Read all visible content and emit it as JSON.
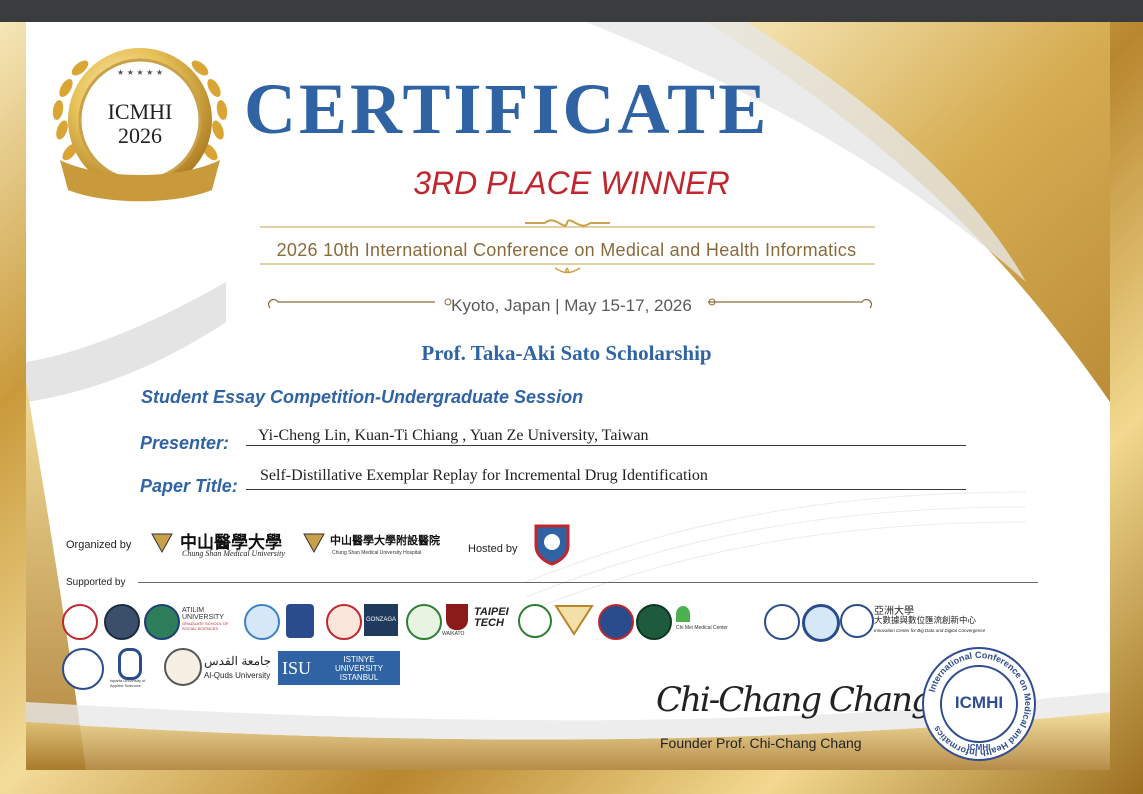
{
  "seal": {
    "line1": "ICMHI",
    "line2": "2026"
  },
  "certificate_title": "CERTIFICATE",
  "award": "3RD PLACE WINNER",
  "conference": "2026 10th International Conference on Medical and Health Informatics",
  "location_date": "Kyoto, Japan | May 15-17, 2026",
  "scholarship": "Prof. Taka-Aki Sato Scholarship",
  "session": "Student Essay Competition-Undergraduate Session",
  "presenter": {
    "label": "Presenter:",
    "value": "Yi-Cheng Lin, Kuan-Ti Chiang , Yuan Ze University, Taiwan"
  },
  "paper_title": {
    "label": "Paper Title:",
    "value": "Self-Distillative Exemplar Replay for Incremental Drug Identification"
  },
  "organized_by": {
    "label": "Organized by",
    "org1": {
      "name": "中山醫學大學",
      "sub": "Chung Shan Medical University"
    },
    "org2": {
      "name": "中山醫學大學附設醫院",
      "sub": "Chung Shan Medical University Hospital"
    }
  },
  "hosted_by": "Hosted by",
  "supported_by": "Supported by",
  "supporter_text": {
    "atilim": "ATILIM UNIVERSITY",
    "atilim_sub": "GRADUATE SCHOOL OF SOCIAL SCIENCES",
    "gonzaga": "GONZAGA",
    "waikato": "WAIKATO",
    "taipei_tech": "TAIPEI TECH",
    "chimei": "Chi Mei Medical Center",
    "asia_cn": "亞洲大學",
    "asia_center": "大數據與數位匯流創新中心",
    "asia_center_en": "Innovation Center for Big Data and Digital Convergence",
    "isparta": "Isparta University of Applied Sciences",
    "alquds_ar": "جامعة القدس",
    "alquds": "Al-Quds University",
    "isu": "ISU",
    "istinye": "ISTINYE UNIVERSITY ISTANBUL"
  },
  "founder_signature": "Chi-Chang Chang",
  "founder": "Founder Prof. Chi-Chang Chang",
  "stamp": {
    "center": "ICMHI",
    "ring": "International Conference on Medical and Health Informatics",
    "bottom": "ICMHI"
  },
  "colors": {
    "blue": "#2f63a3",
    "red": "#c0262d",
    "gold": "#c9a14a"
  }
}
